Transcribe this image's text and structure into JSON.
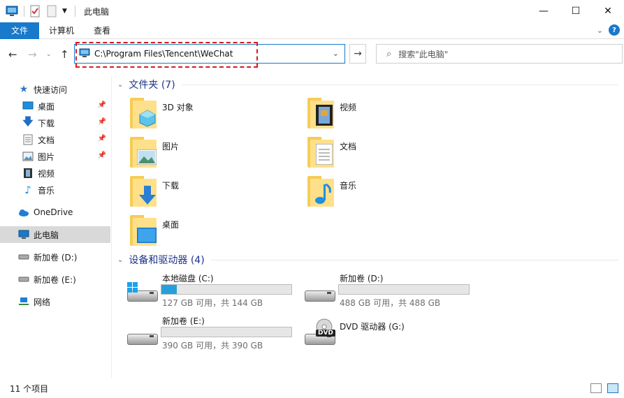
{
  "window": {
    "title": "此电脑"
  },
  "ribbon": {
    "tabs": [
      "文件",
      "计算机",
      "查看"
    ]
  },
  "address": {
    "path": "C:\\Program Files\\Tencent\\WeChat"
  },
  "search": {
    "placeholder": "搜索\"此电脑\""
  },
  "sidebar": {
    "items": [
      {
        "label": "快速访问",
        "icon": "star-icon",
        "pinned": false
      },
      {
        "label": "桌面",
        "icon": "desktop-icon",
        "pinned": true
      },
      {
        "label": "下载",
        "icon": "download-icon",
        "pinned": true
      },
      {
        "label": "文档",
        "icon": "document-icon",
        "pinned": true
      },
      {
        "label": "图片",
        "icon": "picture-icon",
        "pinned": true
      },
      {
        "label": "视频",
        "icon": "video-icon",
        "pinned": false
      },
      {
        "label": "音乐",
        "icon": "music-icon",
        "pinned": false
      },
      {
        "label": "OneDrive",
        "icon": "cloud-icon",
        "pinned": false
      },
      {
        "label": "此电脑",
        "icon": "computer-icon",
        "pinned": false,
        "selected": true
      },
      {
        "label": "新加卷 (D:)",
        "icon": "drive-icon",
        "pinned": false
      },
      {
        "label": "新加卷 (E:)",
        "icon": "drive-icon",
        "pinned": false
      },
      {
        "label": "网络",
        "icon": "network-icon",
        "pinned": false
      }
    ]
  },
  "folders": {
    "header": "文件夹 (7)",
    "items": [
      {
        "label": "3D 对象",
        "icon": "3d-objects-icon"
      },
      {
        "label": "视频",
        "icon": "video-icon"
      },
      {
        "label": "图片",
        "icon": "picture-icon"
      },
      {
        "label": "文档",
        "icon": "document-icon"
      },
      {
        "label": "下载",
        "icon": "download-icon"
      },
      {
        "label": "音乐",
        "icon": "music-icon"
      },
      {
        "label": "桌面",
        "icon": "desktop-icon"
      }
    ]
  },
  "drives": {
    "header": "设备和驱动器 (4)",
    "items": [
      {
        "name": "本地磁盘 (C:)",
        "free": "127 GB 可用，共 144 GB",
        "used_fraction": 0.12
      },
      {
        "name": "新加卷 (D:)",
        "free": "488 GB 可用，共 488 GB",
        "used_fraction": 0.0
      },
      {
        "name": "新加卷 (E:)",
        "free": "390 GB 可用，共 390 GB",
        "used_fraction": 0.0
      },
      {
        "name": "DVD 驱动器 (G:)",
        "free": "",
        "icon_text": "DVD"
      }
    ]
  },
  "status": {
    "count": "11 个项目"
  },
  "colors": {
    "accent": "#1979ca",
    "highlight": "#d61c1c",
    "bar": "#26a0da"
  }
}
